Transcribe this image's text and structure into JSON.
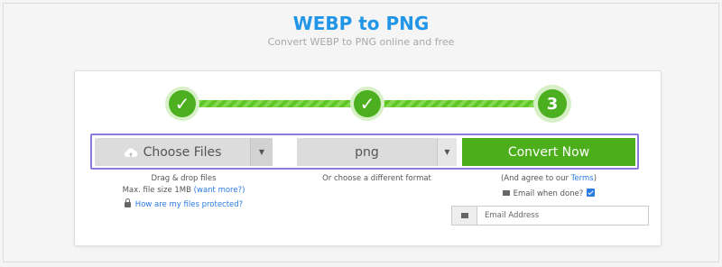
{
  "header": {
    "title": "WEBP to PNG",
    "subtitle": "Convert WEBP to PNG online and free"
  },
  "steps": [
    {
      "label": "✓",
      "state": "done"
    },
    {
      "label": "✓",
      "state": "done"
    },
    {
      "label": "3",
      "state": "current"
    }
  ],
  "upload": {
    "choose_label": "Choose Files",
    "drag_text": "Drag & drop files",
    "max_size_text": "Max. file size 1MB",
    "want_more_link": "(want more?)",
    "protected_link": "How are my files protected?"
  },
  "format": {
    "selected": "png",
    "hint": "Or choose a different format"
  },
  "convert": {
    "button_label": "Convert Now",
    "agree_prefix": "(And agree to our",
    "terms_link": "Terms",
    "agree_suffix": ")",
    "email_when_done_label": "Email when done?",
    "email_when_done_checked": true,
    "email_placeholder": "Email Address"
  },
  "colors": {
    "title_blue": "#2196e8",
    "green": "#4cae1a",
    "highlight_outline": "#8a7bdc",
    "link_blue": "#2a7ae2"
  }
}
